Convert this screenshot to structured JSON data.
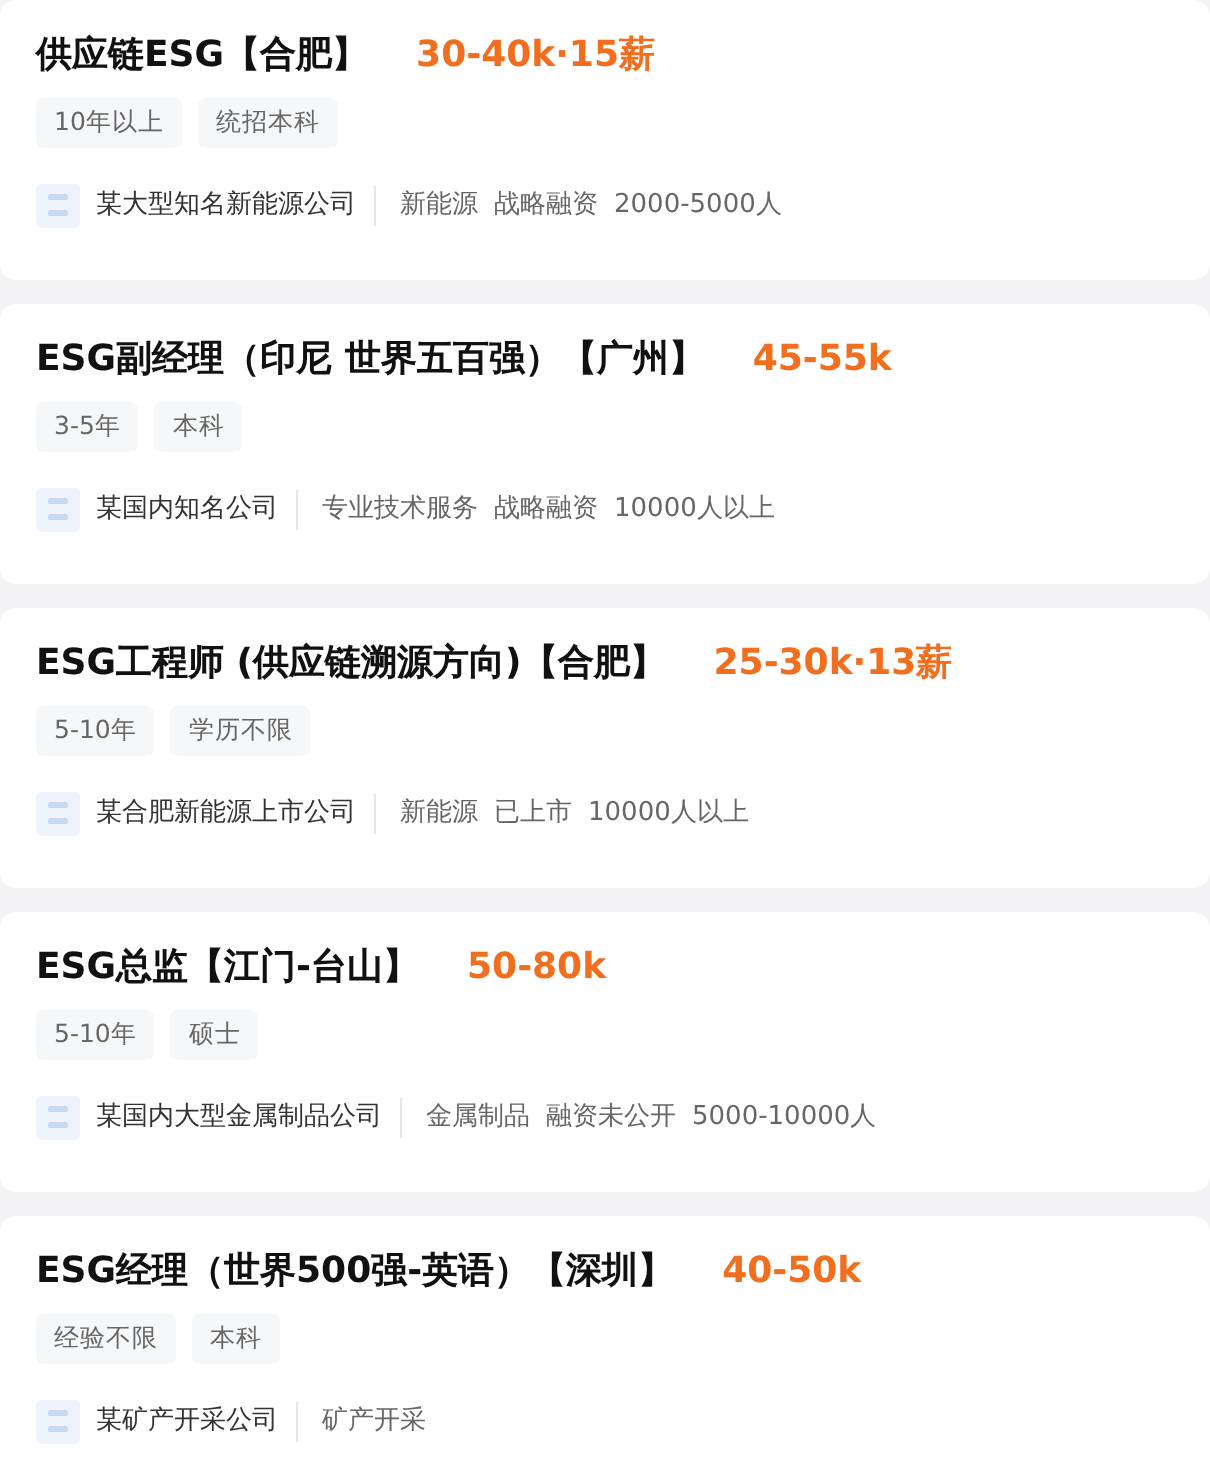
{
  "jobs": [
    {
      "title": "供应链ESG【合肥】",
      "salary": "30-40k·15薪",
      "tags": [
        "10年以上",
        "统招本科"
      ],
      "company": "某大型知名新能源公司",
      "company_info": [
        "新能源",
        "战略融资",
        "2000-5000人"
      ]
    },
    {
      "title": "ESG副经理（印尼 世界五百强）【广州】",
      "salary": "45-55k",
      "tags": [
        "3-5年",
        "本科"
      ],
      "company": "某国内知名公司",
      "company_info": [
        "专业技术服务",
        "战略融资",
        "10000人以上"
      ]
    },
    {
      "title": "ESG工程师 (供应链溯源方向)【合肥】",
      "salary": "25-30k·13薪",
      "tags": [
        "5-10年",
        "学历不限"
      ],
      "company": "某合肥新能源上市公司",
      "company_info": [
        "新能源",
        "已上市",
        "10000人以上"
      ]
    },
    {
      "title": "ESG总监【江门-台山】",
      "salary": "50-80k",
      "tags": [
        "5-10年",
        "硕士"
      ],
      "company": "某国内大型金属制品公司",
      "company_info": [
        "金属制品",
        "融资未公开",
        "5000-10000人"
      ]
    },
    {
      "title": "ESG经理（世界500强-英语）【深圳】",
      "salary": "40-50k",
      "tags": [
        "经验不限",
        "本科"
      ],
      "company": "某矿产开采公司",
      "company_info": [
        "矿产开采"
      ]
    }
  ]
}
